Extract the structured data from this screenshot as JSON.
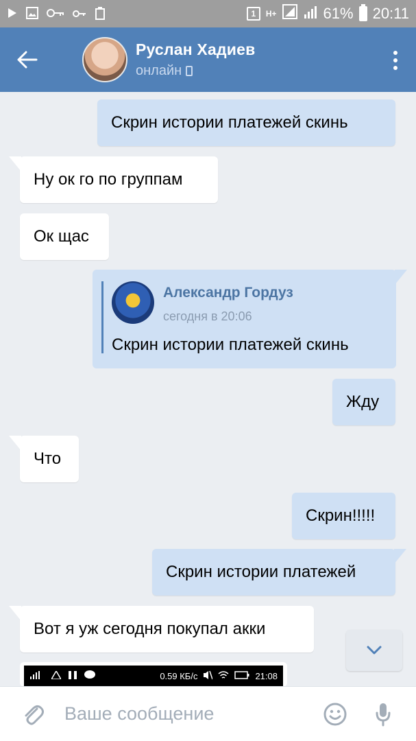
{
  "status_bar": {
    "sim": "1",
    "network": "H+",
    "battery_percent": "61%",
    "time": "20:11",
    "icons": [
      "play-icon",
      "image-icon",
      "key-icon",
      "key-small-icon",
      "recycle-icon",
      "signal-icon",
      "battery-icon"
    ]
  },
  "header": {
    "contact_name": "Руслан Хадиев",
    "status": "онлайн",
    "back_icon": "arrow-left-icon",
    "menu_icon": "more-vertical-icon"
  },
  "messages": [
    {
      "direction": "out",
      "text": "Скрин истории платежей скинь"
    },
    {
      "direction": "in",
      "text": "Ну ок го по группам"
    },
    {
      "direction": "in",
      "text": "Ок щас"
    },
    {
      "direction": "out",
      "forwarded": {
        "author": "Александр Гордуз",
        "time": "сегодня в 20:06",
        "text": "Скрин истории платежей скинь"
      }
    },
    {
      "direction": "out",
      "text": "Жду"
    },
    {
      "direction": "in",
      "text": "Что"
    },
    {
      "direction": "out",
      "text": "Скрин!!!!!"
    },
    {
      "direction": "out",
      "text": "Скрин истории платежей"
    },
    {
      "direction": "in",
      "text": "Вот я уж сегодня покупал акки"
    }
  ],
  "image_preview": {
    "speed": "0.59 КБ/с",
    "time": "21:08"
  },
  "composer": {
    "placeholder": "Ваше сообщение",
    "attach_icon": "paperclip-icon",
    "emoji_icon": "smile-icon",
    "mic_icon": "microphone-icon"
  },
  "colors": {
    "header": "#5181b8",
    "background": "#ebeef2",
    "outgoing_bubble": "#cfe0f4",
    "incoming_bubble": "#ffffff",
    "link_blue": "#4c75a3"
  }
}
